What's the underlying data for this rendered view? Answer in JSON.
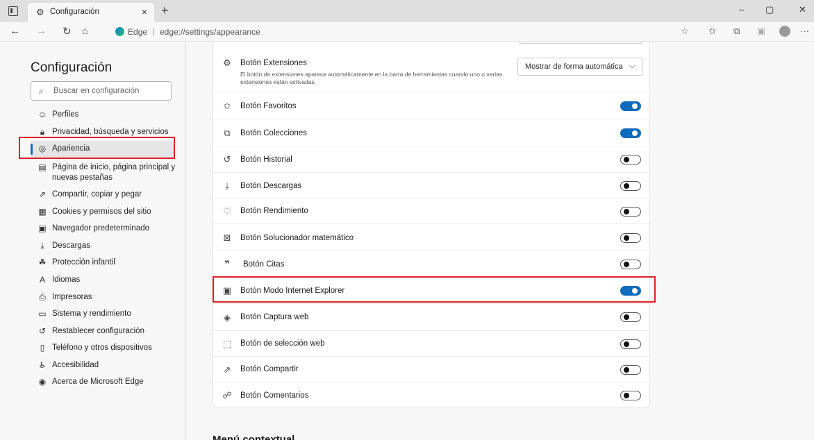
{
  "browser": {
    "tab_title": "Configuración",
    "tab_close": "×",
    "new_tab": "+",
    "address_brand": "Edge",
    "address_sep": "|",
    "address_url": "edge://settings/appearance",
    "window_buttons": {
      "minimize": "–",
      "restore": "▢",
      "close": "✕"
    },
    "overflow": "···"
  },
  "sidebar": {
    "title": "Configuración",
    "search_placeholder": "Buscar en configuración",
    "items": [
      {
        "label": "Perfiles",
        "icon": "profile-icon"
      },
      {
        "label": "Privacidad, búsqueda y servicios",
        "icon": "lock-icon"
      },
      {
        "label": "Apariencia",
        "icon": "palette-icon",
        "active": true
      },
      {
        "label": "Página de inicio, página principal y nuevas pestañas",
        "icon": "home-page-icon"
      },
      {
        "label": "Compartir, copiar y pegar",
        "icon": "share-icon"
      },
      {
        "label": "Cookies y permisos del sitio",
        "icon": "cookies-icon"
      },
      {
        "label": "Navegador predeterminado",
        "icon": "browser-icon"
      },
      {
        "label": "Descargas",
        "icon": "download-icon"
      },
      {
        "label": "Protección infantil",
        "icon": "family-icon"
      },
      {
        "label": "Idiomas",
        "icon": "languages-icon"
      },
      {
        "label": "Impresoras",
        "icon": "printer-icon"
      },
      {
        "label": "Sistema y rendimiento",
        "icon": "system-icon"
      },
      {
        "label": "Restablecer configuración",
        "icon": "reset-icon"
      },
      {
        "label": "Teléfono y otros dispositivos",
        "icon": "phone-icon"
      },
      {
        "label": "Accesibilidad",
        "icon": "accessibility-icon"
      },
      {
        "label": "Acerca de Microsoft Edge",
        "icon": "edge-logo-icon"
      }
    ]
  },
  "settings": {
    "extensions": {
      "label": "Botón Extensiones",
      "description": "El botón de extensiones aparece automáticamente en la barra de herramientas cuando uno o varias extensiones están activadas.",
      "dropdown_value": "Mostrar de forma automática"
    },
    "toggles": [
      {
        "label": "Botón Favoritos",
        "on": true,
        "icon": "favorites-icon"
      },
      {
        "label": "Botón Colecciones",
        "on": true,
        "icon": "collections-icon"
      },
      {
        "label": "Botón Historial",
        "on": false,
        "icon": "history-icon"
      },
      {
        "label": "Botón Descargas",
        "on": false,
        "icon": "downloads-icon"
      },
      {
        "label": "Botón Rendimiento",
        "on": false,
        "icon": "performance-icon"
      },
      {
        "label": "Botón Solucionador matemático",
        "on": false,
        "icon": "math-solver-icon"
      },
      {
        "label": "Botón Citas",
        "on": false,
        "icon": "quotes-icon"
      },
      {
        "label": "Botón Modo Internet Explorer",
        "on": true,
        "icon": "ie-mode-icon"
      },
      {
        "label": "Botón Captura web",
        "on": false,
        "icon": "web-capture-icon"
      },
      {
        "label": "Botón de selección web",
        "on": false,
        "icon": "web-select-icon"
      },
      {
        "label": "Botón Compartir",
        "on": false,
        "icon": "share-icon"
      },
      {
        "label": "Botón Comentarios",
        "on": false,
        "icon": "feedback-icon"
      }
    ]
  },
  "below_heading": "Menú contextual",
  "colors": {
    "accent": "#0f6cbd",
    "highlight": "#e01e24"
  }
}
